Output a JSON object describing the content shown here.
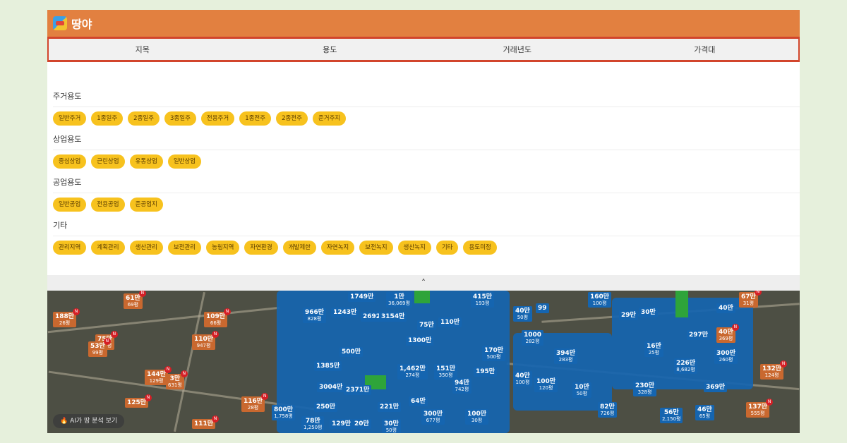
{
  "app": {
    "title": "땅야"
  },
  "tabs": [
    {
      "label": "지목"
    },
    {
      "label": "용도"
    },
    {
      "label": "거래년도"
    },
    {
      "label": "가격대"
    }
  ],
  "groups": [
    {
      "title": "주거용도",
      "chips": [
        "일반주거",
        "1종일주",
        "2종일주",
        "3종일주",
        "전용주거",
        "1종전주",
        "2종전주",
        "준거주지"
      ]
    },
    {
      "title": "상업용도",
      "chips": [
        "중심상업",
        "근린상업",
        "유통상업",
        "일반상업"
      ]
    },
    {
      "title": "공업용도",
      "chips": [
        "일반공업",
        "전용공업",
        "준공업지"
      ]
    },
    {
      "title": "기타",
      "chips": [
        "관리지역",
        "계획관리",
        "생산관리",
        "보전관리",
        "농림지역",
        "자연환경",
        "개발제한",
        "자연녹지",
        "보전녹지",
        "생산녹지",
        "기타",
        "용도미정"
      ]
    }
  ],
  "collapse": {
    "label": "˄"
  },
  "map": {
    "ai_button": "🔥 AI가 땅 분석 보기",
    "markers": [
      {
        "price": "61만",
        "sub": "69평",
        "color": "orange"
      },
      {
        "price": "188만",
        "sub": "26평",
        "color": "orange"
      },
      {
        "price": "109만",
        "sub": "66평",
        "color": "orange"
      },
      {
        "price": "75만",
        "sub": "207평",
        "color": "orange"
      },
      {
        "price": "53만",
        "sub": "99평",
        "color": "orange"
      },
      {
        "price": "110만",
        "sub": "947평",
        "color": "orange"
      },
      {
        "price": "144만",
        "sub": "129평",
        "color": "orange"
      },
      {
        "price": "3만",
        "sub": "631평",
        "color": "orange"
      },
      {
        "price": "125만",
        "sub": "",
        "color": "orange"
      },
      {
        "price": "116만",
        "sub": "28평",
        "color": "orange"
      },
      {
        "price": "111만",
        "sub": "",
        "color": "orange"
      },
      {
        "price": "800만",
        "sub": "1,758평",
        "color": "blue"
      },
      {
        "price": "966만",
        "sub": "828평",
        "color": "blue"
      },
      {
        "price": "1243만",
        "sub": "",
        "color": "blue"
      },
      {
        "price": "1749만",
        "sub": "",
        "color": "blue"
      },
      {
        "price": "2692",
        "sub": "",
        "color": "blue"
      },
      {
        "price": "1만",
        "sub": "36,069평",
        "color": "blue"
      },
      {
        "price": "3154만",
        "sub": "",
        "color": "blue"
      },
      {
        "price": "75만",
        "sub": "",
        "color": "blue"
      },
      {
        "price": "110만",
        "sub": "",
        "color": "blue"
      },
      {
        "price": "415만",
        "sub": "193평",
        "color": "blue"
      },
      {
        "price": "40만",
        "sub": "50평",
        "color": "blue"
      },
      {
        "price": "99",
        "sub": "",
        "color": "blue"
      },
      {
        "price": "160만",
        "sub": "100평",
        "color": "blue"
      },
      {
        "price": "29만",
        "sub": "",
        "color": "blue"
      },
      {
        "price": "30만",
        "sub": "",
        "color": "blue"
      },
      {
        "price": "40만",
        "sub": "",
        "color": "blue"
      },
      {
        "price": "67만",
        "sub": "31평",
        "color": "orange"
      },
      {
        "price": "1000",
        "sub": "282평",
        "color": "blue"
      },
      {
        "price": "297만",
        "sub": "",
        "color": "blue"
      },
      {
        "price": "40만",
        "sub": "369평",
        "color": "orange"
      },
      {
        "price": "500만",
        "sub": "",
        "color": "blue"
      },
      {
        "price": "1385만",
        "sub": "",
        "color": "blue"
      },
      {
        "price": "1300만",
        "sub": "",
        "color": "blue"
      },
      {
        "price": "1,462만",
        "sub": "274평",
        "color": "blue"
      },
      {
        "price": "151만",
        "sub": "350평",
        "color": "blue"
      },
      {
        "price": "170만",
        "sub": "500평",
        "color": "blue"
      },
      {
        "price": "394만",
        "sub": "283평",
        "color": "blue"
      },
      {
        "price": "16만",
        "sub": "25평",
        "color": "blue"
      },
      {
        "price": "300만",
        "sub": "260평",
        "color": "blue"
      },
      {
        "price": "226만",
        "sub": "8,682평",
        "color": "blue"
      },
      {
        "price": "132만",
        "sub": "124평",
        "color": "orange"
      },
      {
        "price": "3004만",
        "sub": "",
        "color": "blue"
      },
      {
        "price": "2371만",
        "sub": "",
        "color": "blue"
      },
      {
        "price": "94만",
        "sub": "742평",
        "color": "blue"
      },
      {
        "price": "195만",
        "sub": "",
        "color": "blue"
      },
      {
        "price": "40만",
        "sub": "100평",
        "color": "blue"
      },
      {
        "price": "100만",
        "sub": "120평",
        "color": "blue"
      },
      {
        "price": "10만",
        "sub": "50평",
        "color": "blue"
      },
      {
        "price": "230만",
        "sub": "328평",
        "color": "blue"
      },
      {
        "price": "369만",
        "sub": "",
        "color": "blue"
      },
      {
        "price": "250만",
        "sub": "",
        "color": "blue"
      },
      {
        "price": "221만",
        "sub": "",
        "color": "blue"
      },
      {
        "price": "64만",
        "sub": "",
        "color": "blue"
      },
      {
        "price": "300만",
        "sub": "677평",
        "color": "blue"
      },
      {
        "price": "100만",
        "sub": "30평",
        "color": "blue"
      },
      {
        "price": "82만",
        "sub": "726평",
        "color": "blue"
      },
      {
        "price": "56만",
        "sub": "2,150평",
        "color": "blue"
      },
      {
        "price": "46만",
        "sub": "65평",
        "color": "blue"
      },
      {
        "price": "137만",
        "sub": "555평",
        "color": "orange"
      },
      {
        "price": "78만",
        "sub": "1,250평",
        "color": "blue"
      },
      {
        "price": "129만",
        "sub": "",
        "color": "blue"
      },
      {
        "price": "20만",
        "sub": "",
        "color": "blue"
      },
      {
        "price": "30만",
        "sub": "50평",
        "color": "blue"
      }
    ]
  }
}
